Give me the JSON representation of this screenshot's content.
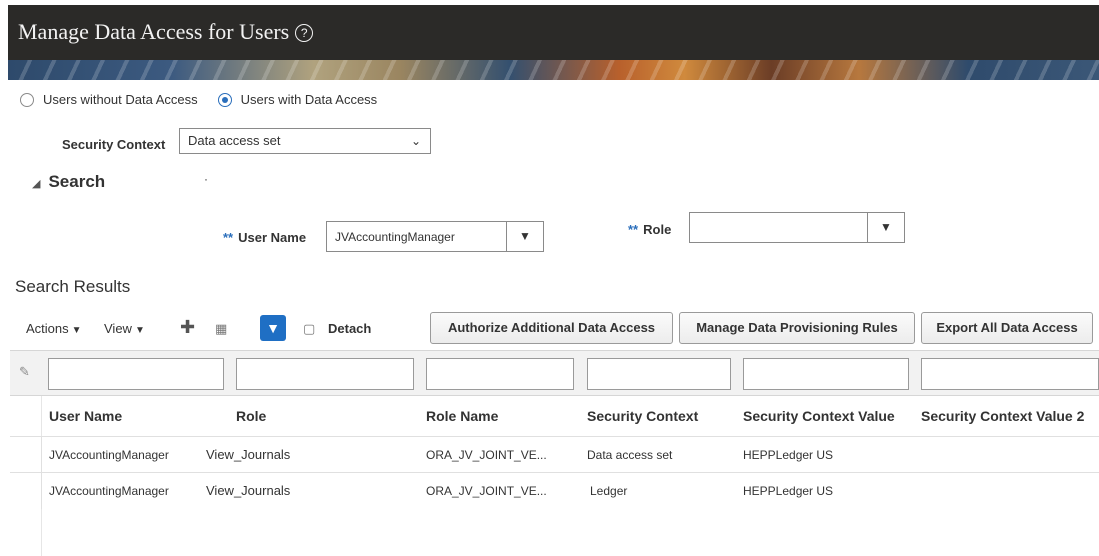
{
  "header": {
    "title": "Manage Data Access for Users",
    "help_symbol": "?"
  },
  "filter_mode": {
    "options": [
      {
        "label": "Users without Data Access",
        "selected": false
      },
      {
        "label": "Users with Data Access",
        "selected": true
      }
    ]
  },
  "security_context": {
    "label": "Security Context",
    "value": "Data access set"
  },
  "search": {
    "heading": "Search",
    "required_marker": "**",
    "user_name": {
      "label": "User Name",
      "value": "JVAccountingManager"
    },
    "role": {
      "label": "Role",
      "value": ""
    }
  },
  "results": {
    "title": "Search Results",
    "toolbar": {
      "actions": "Actions",
      "view": "View",
      "detach": "Detach"
    },
    "buttons": {
      "authorize": "Authorize Additional Data Access",
      "rules": "Manage Data Provisioning Rules",
      "export": "Export All Data Access"
    },
    "columns": [
      "User Name",
      "Role",
      "Role Name",
      "Security Context",
      "Security Context Value",
      "Security Context Value 2"
    ],
    "rows": [
      [
        "JVAccountingManager",
        "View_Journals",
        "ORA_JV_JOINT_VE...",
        "Data access set",
        "HEPPLedger US",
        ""
      ],
      [
        "JVAccountingManager",
        "View_Journals",
        "ORA_JV_JOINT_VE...",
        "Ledger",
        "HEPPLedger US",
        ""
      ]
    ]
  },
  "colors": {
    "header_bg": "#2b2a28",
    "accent": "#2a6ebb",
    "query_button": "#1f6fc4"
  }
}
